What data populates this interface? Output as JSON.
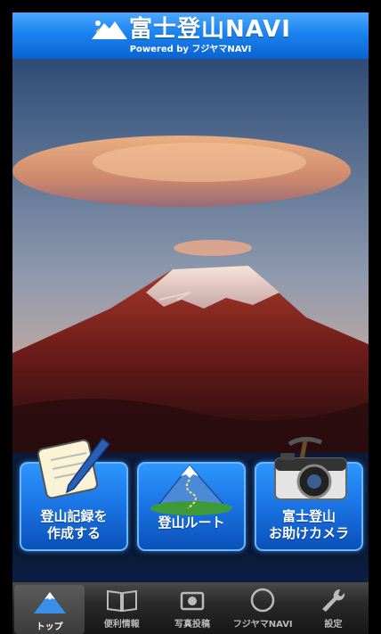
{
  "header": {
    "title": "富士登山NAVI",
    "subtitle": "Powered by フジヤマNAVI"
  },
  "actions": [
    {
      "label": "登山記録を\n作成する",
      "icon": "notebook-pen-icon"
    },
    {
      "label": "登山ルート",
      "icon": "mountain-map-icon"
    },
    {
      "label": "富士登山\nお助けカメラ",
      "icon": "camera-pickaxe-icon"
    }
  ],
  "tabs": [
    {
      "label": "トップ",
      "icon": "mountain-icon",
      "active": true
    },
    {
      "label": "便利情報",
      "icon": "book-info-icon",
      "active": false
    },
    {
      "label": "写真投稿",
      "icon": "camera-icon",
      "active": false
    },
    {
      "label": "フジヤマNAVI",
      "icon": "compass-icon",
      "active": false
    },
    {
      "label": "設定",
      "icon": "wrench-icon",
      "active": false
    }
  ],
  "colors": {
    "header": "#1b83ef",
    "button": "#1c77e7",
    "tabbar": "#2a2a2a"
  }
}
